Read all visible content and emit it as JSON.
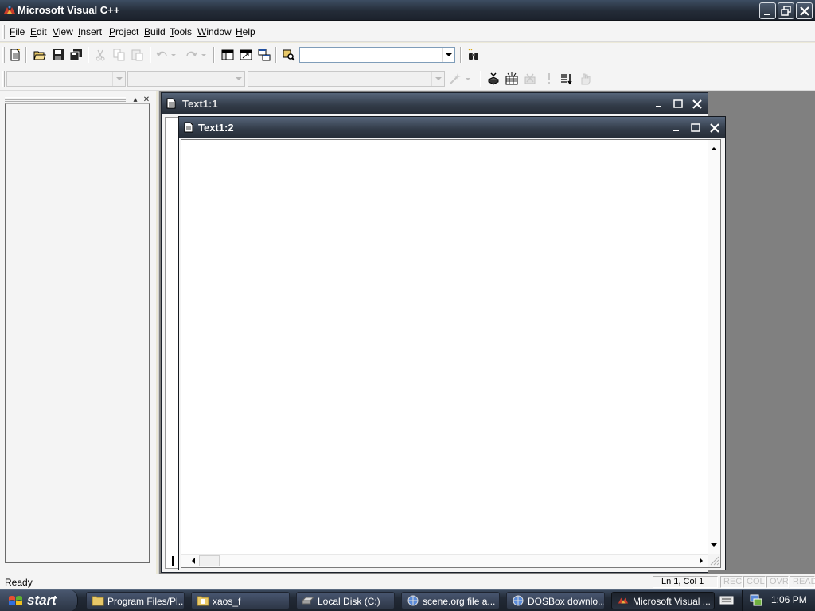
{
  "window": {
    "title": "Microsoft Visual C++"
  },
  "menu": [
    {
      "mn": "F",
      "rest": "ile"
    },
    {
      "mn": "E",
      "rest": "dit"
    },
    {
      "mn": "V",
      "rest": "iew"
    },
    {
      "mn": "I",
      "rest": "nsert"
    },
    {
      "mn": "P",
      "rest": "roject"
    },
    {
      "mn": "B",
      "rest": "uild"
    },
    {
      "mn": "T",
      "rest": "ools"
    },
    {
      "mn": "W",
      "rest": "indow"
    },
    {
      "mn": "H",
      "rest": "elp"
    }
  ],
  "toolbar": {
    "find_combo_value": "",
    "class_combo_value": "",
    "filter_combo_value": "",
    "members_combo_value": ""
  },
  "documents": {
    "back_window_title": "Text1:1",
    "front_window_title": "Text1:2"
  },
  "statusbar": {
    "status": "Ready",
    "position": "Ln 1, Col 1",
    "indicators": [
      "REC",
      "COL",
      "OVR",
      "READ"
    ]
  },
  "taskbar": {
    "start_label": "start",
    "tasks": [
      {
        "label": "Program Files/Pl..."
      },
      {
        "label": "xaos_f"
      },
      {
        "label": "Local Disk (C:)"
      },
      {
        "label": "scene.org file a..."
      },
      {
        "label": "DOSBox downlo..."
      },
      {
        "label": "Microsoft Visual ..."
      }
    ],
    "clock": "1:06 PM"
  },
  "colors": {
    "titlebar": "#242c38",
    "chrome": "#f4f4f4",
    "mdi_background": "#808080",
    "editor_background": "#ffffff"
  }
}
